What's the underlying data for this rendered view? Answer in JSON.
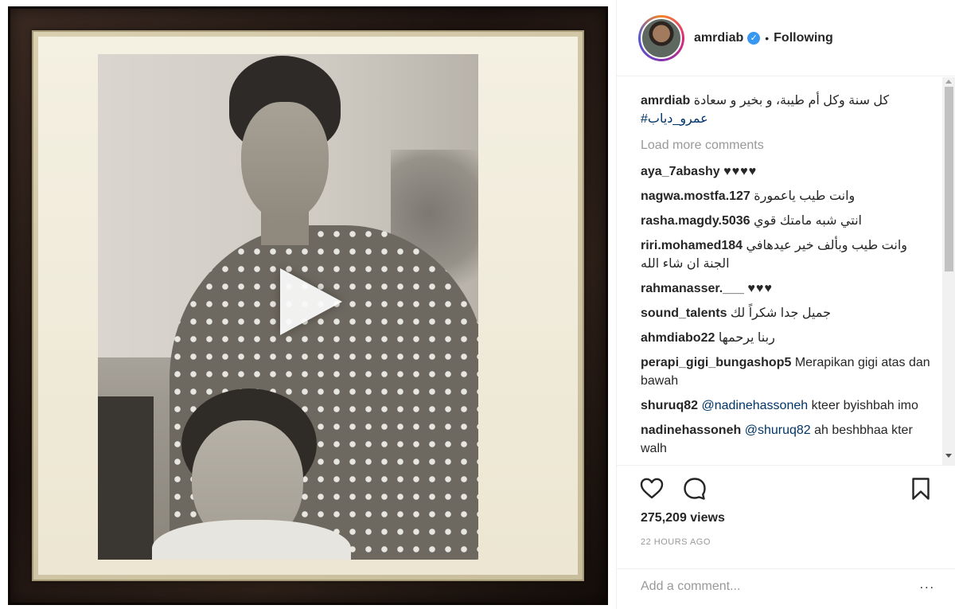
{
  "post": {
    "username": "amrdiab",
    "follow_status": "Following",
    "dot": "•",
    "caption": {
      "user": "amrdiab",
      "text": "كل سنة وكل أم طيبة، و بخير و سعادة",
      "hashtag": "#عمرو_دياب"
    },
    "load_more": "Load more comments",
    "comments": [
      {
        "user": "aya_7abashy",
        "text": "♥♥♥♥"
      },
      {
        "user": "nagwa.mostfa.127",
        "text": "وانت طيب ياعمورة"
      },
      {
        "user": "rasha.magdy.5036",
        "text": "انتي شبه مامتك قوي"
      },
      {
        "user": "riri.mohamed184",
        "text": "وانت طيب وبألف خير عيدهافي الجنة ان شاء الله"
      },
      {
        "user": "rahmanasser.___",
        "text": "♥♥♥"
      },
      {
        "user": "sound_talents",
        "text": "جميل جدا شكراً لك"
      },
      {
        "user": "ahmdiabo22",
        "text": "ربنا يرحمها"
      },
      {
        "user": "perapi_gigi_bungashop5",
        "text": "Merapikan gigi atas dan bawah"
      },
      {
        "user": "shuruq82",
        "mention": "@nadinehassoneh",
        "text": "kteer byishbah imo"
      },
      {
        "user": "nadinehassoneh",
        "mention": "@shuruq82",
        "text": "ah beshbhaa kter walh"
      }
    ],
    "views": "275,209 views",
    "timestamp": "22 HOURS AGO",
    "add_comment_placeholder": "Add a comment...",
    "more_options": "..."
  },
  "icons": {
    "verified": "verified-badge-icon",
    "like": "heart-icon",
    "comment": "comment-bubble-icon",
    "save": "bookmark-icon",
    "play": "play-icon"
  },
  "colors": {
    "link": "#003569",
    "muted": "#999999",
    "verified": "#3897f0",
    "text": "#262626"
  }
}
